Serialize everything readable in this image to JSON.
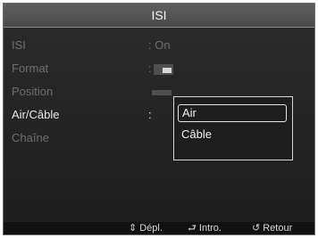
{
  "title": "ISI",
  "menu": [
    {
      "label": "ISI",
      "value": ": On"
    },
    {
      "label": "Format",
      "value": ":"
    },
    {
      "label": "Position",
      "value": ""
    },
    {
      "label": "Air/Câble",
      "value": ":"
    },
    {
      "label": "Chaîne",
      "value": ""
    }
  ],
  "dropdown": {
    "options": [
      "Air",
      "Câble"
    ],
    "selected": "Air"
  },
  "footer": {
    "move_icon": "⇕",
    "move_label": "Dépl.",
    "enter_icon": "⮐",
    "enter_label": "Intro.",
    "return_icon": "↺",
    "return_label": "Retour"
  },
  "icons": {
    "format": "format-pip-icon",
    "position": "position-icon"
  }
}
